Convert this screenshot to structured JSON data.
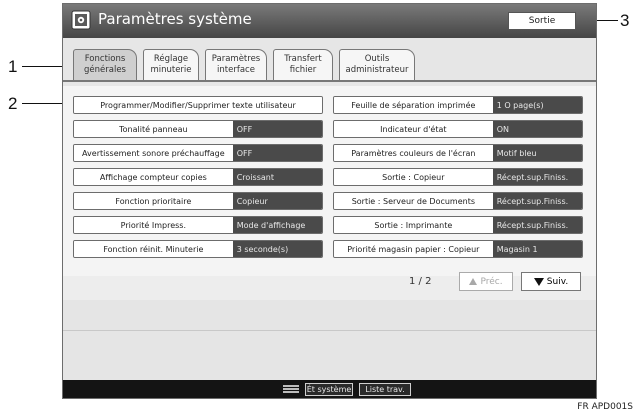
{
  "window": {
    "title": "Paramètres système",
    "exit_label": "Sortie"
  },
  "callouts": [
    "1",
    "2",
    "3"
  ],
  "tabs": [
    {
      "line1": "Fonctions",
      "line2": "générales",
      "active": true
    },
    {
      "line1": "Réglage",
      "line2": "minuterie",
      "active": false
    },
    {
      "line1": "Paramètres",
      "line2": "interface",
      "active": false
    },
    {
      "line1": "Transfert",
      "line2": "fichier",
      "active": false
    },
    {
      "line1": "Outils",
      "line2": "administrateur",
      "active": false
    }
  ],
  "settings": {
    "program_button": "Programmer/Modifier/Supprimer texte utilisateur",
    "left": [
      {
        "label": "Tonalité panneau",
        "value": "OFF"
      },
      {
        "label": "Avertissement sonore préchauffage",
        "value": "OFF"
      },
      {
        "label": "Affichage compteur copies",
        "value": "Croissant"
      },
      {
        "label": "Fonction prioritaire",
        "value": "Copieur"
      },
      {
        "label": "Priorité Impress.",
        "value": "Mode d'affichage"
      },
      {
        "label": "Fonction réinit. Minuterie",
        "value": "3 seconde(s)"
      }
    ],
    "right": [
      {
        "label": "Feuille de séparation imprimée",
        "value": "1 O page(s)"
      },
      {
        "label": "Indicateur d'état",
        "value": "ON"
      },
      {
        "label": "Paramètres couleurs de l'écran",
        "value": "Motif bleu"
      },
      {
        "label": "Sortie : Copieur",
        "value": "Récept.sup.Finiss."
      },
      {
        "label": "Sortie : Serveur de Documents",
        "value": "Récept.sup.Finiss."
      },
      {
        "label": "Sortie : Imprimante",
        "value": "Récept.sup.Finiss."
      },
      {
        "label": "Priorité magasin papier : Copieur",
        "value": "Magasin 1"
      }
    ]
  },
  "pager": {
    "text": "1 / 2",
    "prev_label": "Préc.",
    "next_label": "Suiv."
  },
  "statusbar": {
    "status_label": "Ét système",
    "jobs_label": "Liste trav."
  },
  "figure_label": "FR APD001S"
}
